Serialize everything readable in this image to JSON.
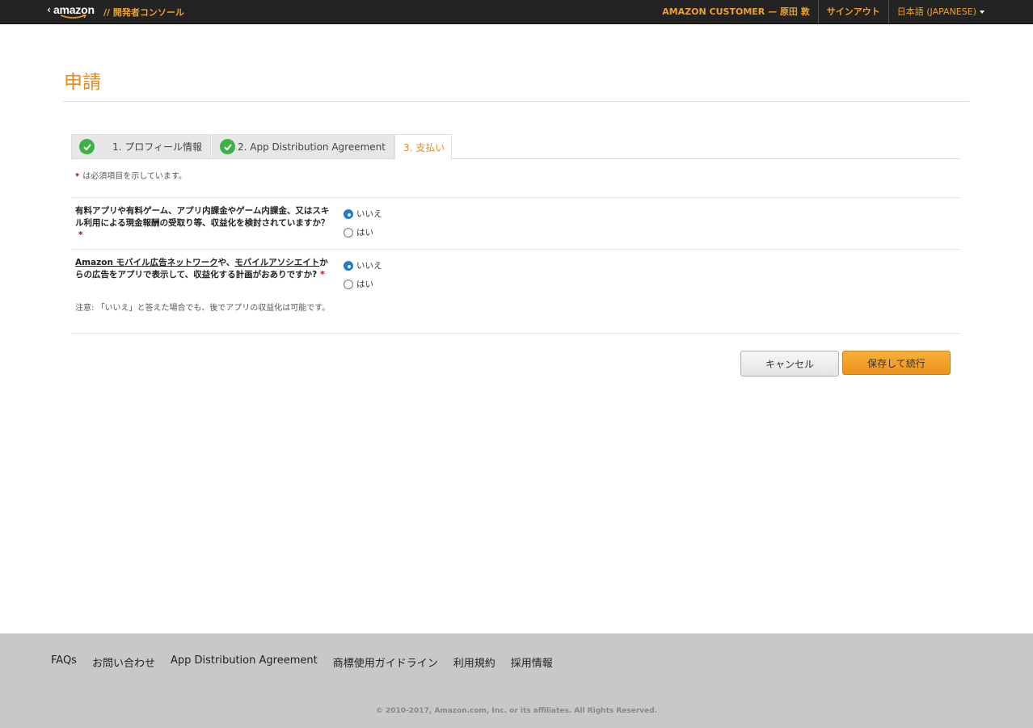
{
  "header": {
    "logo_text": "amazon",
    "console_title": "// 開発者コンソール",
    "user_label": "AMAZON CUSTOMER — 原田 敦",
    "signout_label": "サインアウト",
    "language_label": "日本語 (JAPANESE)"
  },
  "page": {
    "title": "申請"
  },
  "tabs": [
    {
      "label": "1. プロフィール情報",
      "state": "complete"
    },
    {
      "label": "2. App Distribution Agreement",
      "state": "complete"
    },
    {
      "label": "3. 支払い",
      "state": "active"
    }
  ],
  "form": {
    "required_note": "は必須項目を示しています。",
    "required_star": "*",
    "q1": {
      "text": "有料アプリや有料ゲーム、アプリ内課金やゲーム内課金、又はスキル利用による現金報酬の受取り等、収益化を検討されていますか？",
      "options": [
        "いいえ",
        "はい"
      ],
      "selected": "いいえ"
    },
    "q2": {
      "link1": "Amazon モバイル広告ネットワーク",
      "connector": "や、",
      "link2": "モバイルアソシエイト",
      "rest": "からの広告をアプリで表示して、収益化する計画がおありですか?",
      "note": "注意: 「いいえ」と答えた場合でも、後でアプリの収益化は可能です。",
      "options": [
        "いいえ",
        "はい"
      ],
      "selected": "いいえ"
    },
    "cancel_label": "キャンセル",
    "save_label": "保存して続行"
  },
  "footer": {
    "links": [
      "FAQs",
      "お問い合わせ",
      "App Distribution Agreement",
      "商標使用ガイドライン",
      "利用規約",
      "採用情報"
    ],
    "copyright": "© 2010-2017, Amazon.com, Inc. or its affiliates. All Rights Reserved."
  },
  "colors": {
    "accent_orange": "#e8891b",
    "topbar_bg": "#232323",
    "check_green": "#3db046",
    "radio_blue": "#1f7ad8",
    "footer_bg": "#c8c8c8"
  },
  "icons": {
    "tab_complete": "check-circle-icon",
    "language_dropdown": "caret-down-icon",
    "logo_back": "chevron-left-icon"
  }
}
